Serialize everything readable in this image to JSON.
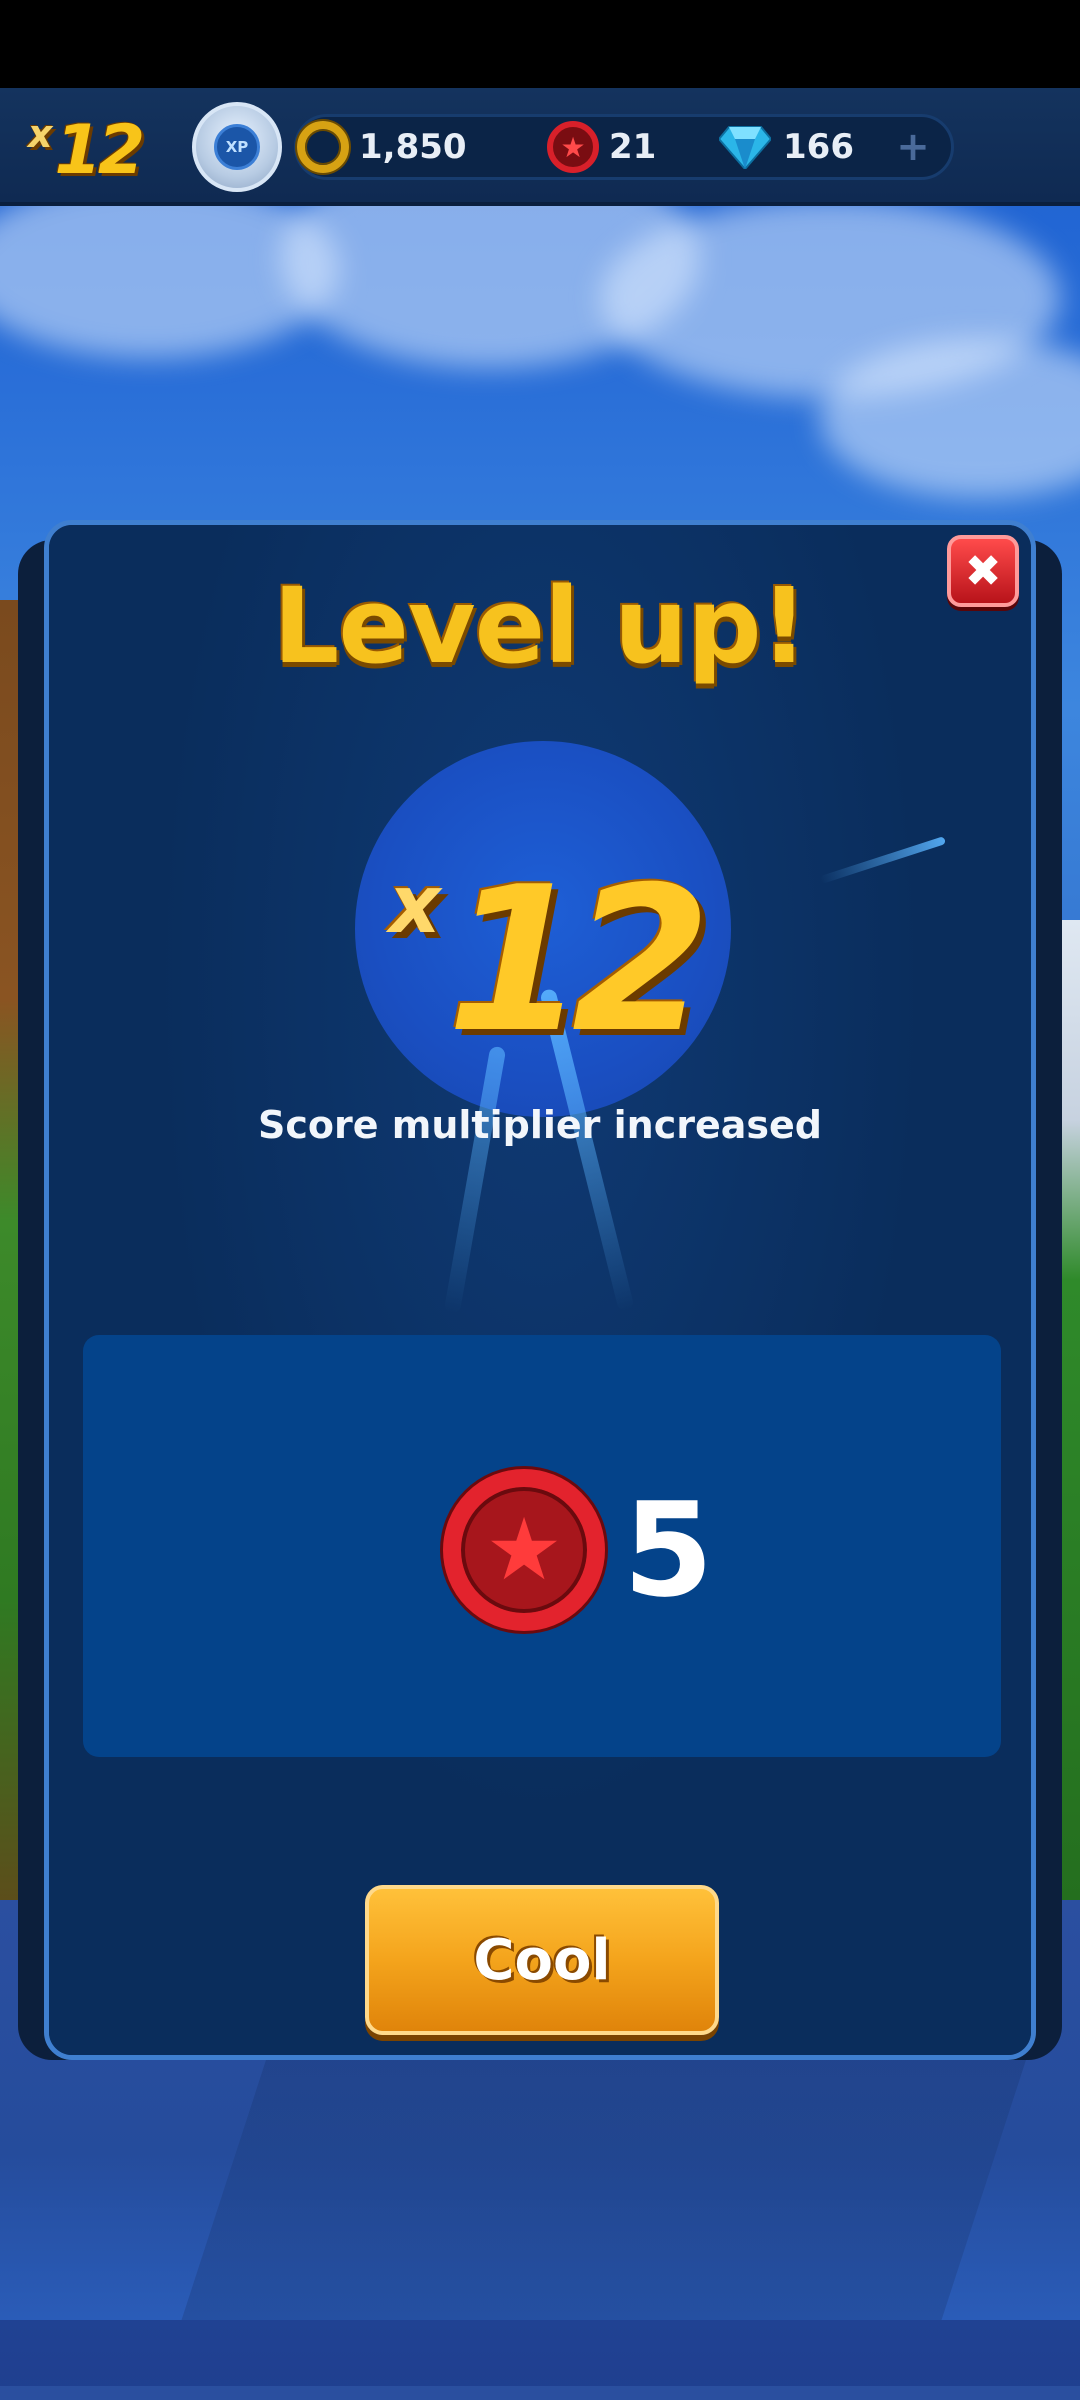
{
  "hud": {
    "multiplier_prefix": "x",
    "multiplier_value": "12",
    "xp_label": "XP",
    "rings": "1,850",
    "red_star_rings": "21",
    "gems": "166",
    "add_label": "+"
  },
  "dialog": {
    "title": "Level up!",
    "multiplier_prefix": "x",
    "multiplier_value": "12",
    "subtitle": "Score multiplier increased",
    "reward_count": "5",
    "confirm_label": "Cool",
    "close_label": "✖"
  },
  "icons": {
    "ring": "gold-ring-icon",
    "red_star_ring": "red-star-ring-icon",
    "gem": "blue-gem-icon",
    "xp": "xp-badge-icon",
    "close": "close-icon"
  },
  "colors": {
    "title_gold": "#f7c21e",
    "dialog_bg": "#0a2d5c",
    "reward_panel": "#04438a",
    "button_orange": "#f4a41c",
    "close_red": "#e0202a"
  }
}
